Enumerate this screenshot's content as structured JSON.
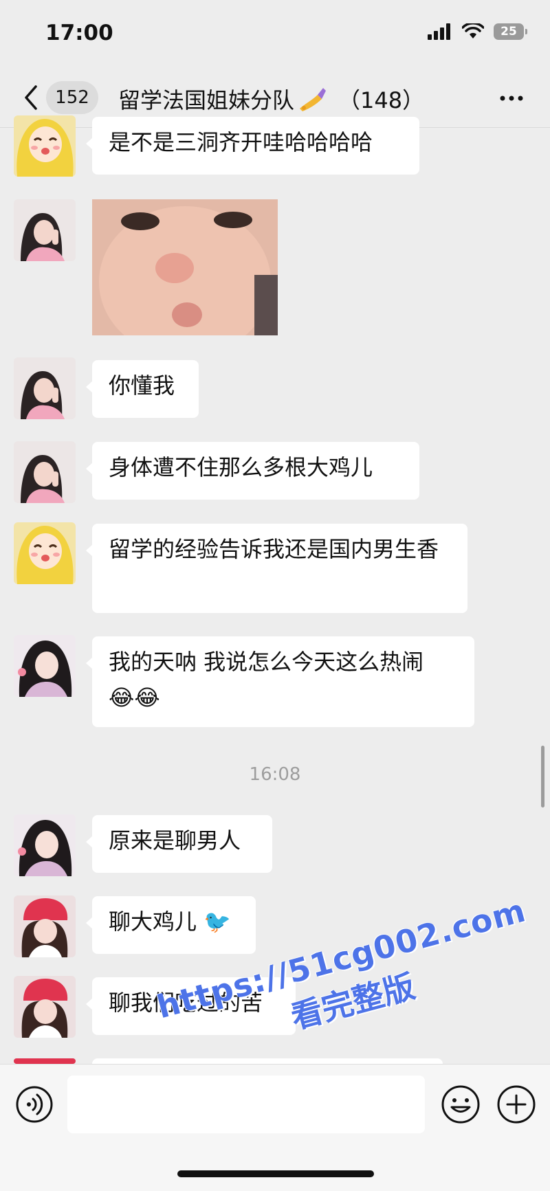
{
  "status_bar": {
    "time": "17:00",
    "battery": "25"
  },
  "nav": {
    "unread_count": "152",
    "title": "留学法国姐妹分队",
    "member_count": "（148）"
  },
  "messages": [
    {
      "avatar": "cartoon-blonde-girl-avatar",
      "text": "是不是三洞齐开哇哈哈哈哈"
    },
    {
      "avatar": "girl-pink-sweater-avatar",
      "image": "crying-baby-sticker"
    },
    {
      "avatar": "girl-pink-sweater-avatar",
      "text": "你懂我"
    },
    {
      "avatar": "girl-pink-sweater-avatar",
      "text": "身体遭不住那么多根大鸡儿"
    },
    {
      "avatar": "cartoon-blonde-girl-avatar",
      "text": "留学的经验告诉我还是国内男生香"
    },
    {
      "avatar": "girl-floral-dress-avatar",
      "text": "我的天呐 我说怎么今天这么热闹",
      "emoji": "😂😂"
    },
    {
      "avatar": "girl-floral-dress-avatar",
      "text": "原来是聊男人"
    },
    {
      "avatar": "girl-red-beanie-avatar",
      "text": "聊大鸡儿",
      "emoji": "🐦"
    },
    {
      "avatar": "girl-red-beanie-avatar",
      "text": "聊我们吃过的苦"
    }
  ],
  "timestamp": "16:08",
  "input": {
    "placeholder": ""
  },
  "watermark": {
    "url": "https://51cg002.com",
    "subtitle": "看完整版"
  },
  "colors": {
    "background": "#ededed",
    "bubble": "#ffffff",
    "watermark": "#4d73e8"
  }
}
